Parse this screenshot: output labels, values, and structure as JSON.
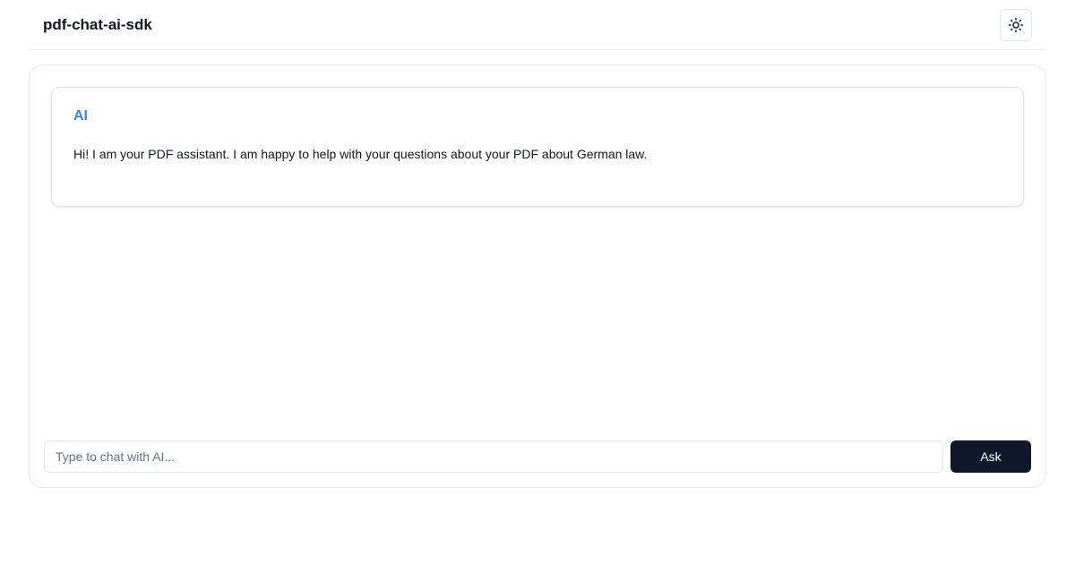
{
  "header": {
    "title": "pdf-chat-ai-sdk",
    "theme_toggle_icon": "sun-icon"
  },
  "messages": [
    {
      "author": "AI",
      "text": "Hi! I am your PDF assistant. I am happy to help with your questions about your PDF about German law."
    }
  ],
  "composer": {
    "placeholder": "Type to chat with AI...",
    "value": "",
    "ask_label": "Ask"
  },
  "colors": {
    "ai_author": "#3b82f6",
    "primary_button": "#0f172a"
  }
}
